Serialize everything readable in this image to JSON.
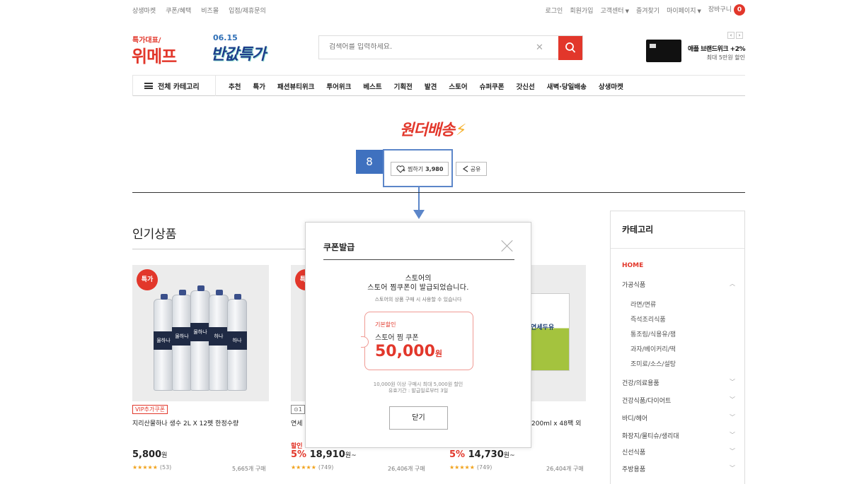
{
  "topbar": {
    "left_links": [
      "상생마켓",
      "쿠폰/혜택",
      "비즈몰",
      "입점/제휴문의"
    ],
    "right_links": [
      {
        "label": "로그인",
        "caret": false
      },
      {
        "label": "회원가입",
        "caret": false
      },
      {
        "label": "고객센터",
        "caret": true
      },
      {
        "label": "즐겨찾기",
        "caret": false
      },
      {
        "label": "마이페이지",
        "caret": true
      },
      {
        "label": "장바구니",
        "caret": false
      }
    ],
    "cart_count": "0"
  },
  "header": {
    "logo_tagline": "특가대표/",
    "logo_text": "위메프",
    "promo_date": "06.15",
    "promo_text": "반값특가",
    "search_placeholder": "검색어를 입력하세요.",
    "banner_title": "애플 브랜드위크 +2%",
    "banner_subtitle": "최대 5만원 할인"
  },
  "nav": {
    "category_label": "전체 카테고리",
    "items": [
      "추천",
      "특가",
      "패션뷰티위크",
      "투어위크",
      "베스트",
      "기획전",
      "발견",
      "스토어",
      "슈퍼쿠폰",
      "갓신선",
      "새벽·당일배송",
      "상생마켓"
    ]
  },
  "store": {
    "name": "원더배송",
    "like_label": "찜하기",
    "like_count": "3,980",
    "share_label": "공유"
  },
  "annotation": {
    "step_number": "8"
  },
  "popular": {
    "title": "인기상품",
    "products": [
      {
        "badge": "특가",
        "tag": "VIP추가쿠폰",
        "name": "지리산물하나 생수 2L X 12펫 한정수량",
        "sale_label": "",
        "discount": "",
        "price": "5,800",
        "price_unit": "원",
        "price_suffix": "",
        "stars": "★★★★★",
        "reviews": "(53)",
        "sold": "5,665개 구매"
      },
      {
        "badge": "특가",
        "tag": "⊙1",
        "name": "연세",
        "sale_label": "할인",
        "discount": "5%",
        "price": "18,910",
        "price_unit": "원",
        "price_suffix": "~",
        "stars": "★★★★★",
        "reviews": "(749)",
        "sold": "26,406개 구매"
      },
      {
        "badge": "",
        "tag": "",
        "name": "200ml x 48팩 외",
        "sale_label": "",
        "discount": "5%",
        "price": "14,730",
        "price_unit": "원",
        "price_suffix": "~",
        "stars": "★★★★★",
        "reviews": "(749)",
        "sold": "26,404개 구매"
      }
    ]
  },
  "categories": {
    "title": "카테고리",
    "home": "HOME",
    "expanded": "가공식품",
    "sub_items": [
      "라면/면류",
      "즉석조리식품",
      "통조림/식용유/잼",
      "과자/베이커리/떡",
      "조미료/소스/설탕"
    ],
    "others": [
      "건강/의료용품",
      "건강식품/다이어트",
      "바디/헤어",
      "화장지/물티슈/생리대",
      "신선식품",
      "주방용품"
    ]
  },
  "modal": {
    "title": "쿠폰발급",
    "message_line1": "스토어의",
    "message_line2": "스토어 찜쿠폰이 발급되었습니다.",
    "note": "스토어의 상품 구매 시 사용할 수 있습니다",
    "coupon_type": "기본할인",
    "coupon_name": "스토어 찜 쿠폰",
    "coupon_amount": "50,000",
    "coupon_unit": "원",
    "condition": "10,000원 이상 구매시 최대 5,000원 할인",
    "validity": "유효기간 : 발급일로부터 3일",
    "close_label": "닫기"
  },
  "colors": {
    "accent": "#e2372b",
    "annotation_blue": "#3f71bf",
    "star": "#f1a21b"
  }
}
